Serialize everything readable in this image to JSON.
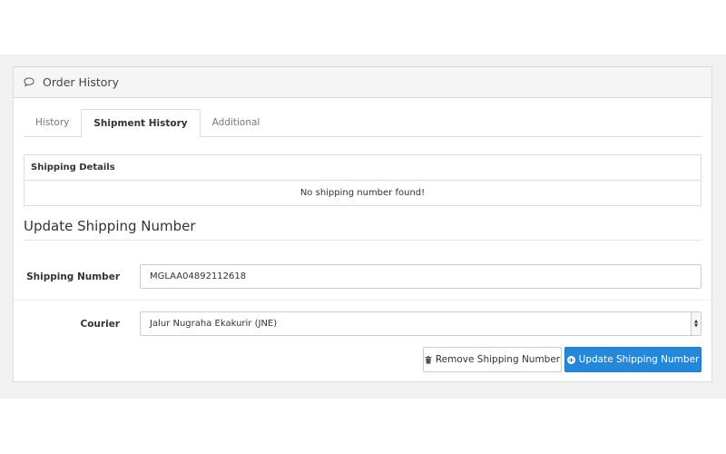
{
  "panel": {
    "title": "Order History",
    "title_icon": "comment-icon"
  },
  "tabs": [
    {
      "label": "History",
      "active": false
    },
    {
      "label": "Shipment History",
      "active": true
    },
    {
      "label": "Additional",
      "active": false
    }
  ],
  "shipping_table": {
    "header": "Shipping Details",
    "empty_message": "No shipping number found!"
  },
  "update_section": {
    "title": "Update Shipping Number",
    "shipping_number_label": "Shipping Number",
    "shipping_number_value": "MGLAA04892112618",
    "courier_label": "Courier",
    "courier_value": "Jalur Nugraha Ekakurir (JNE)"
  },
  "buttons": {
    "remove_label": "Remove Shipping Number",
    "remove_icon": "trash-icon",
    "update_label": "Update Shipping Number",
    "update_icon": "plus-circle-icon"
  },
  "colors": {
    "primary": "#2487d8"
  }
}
